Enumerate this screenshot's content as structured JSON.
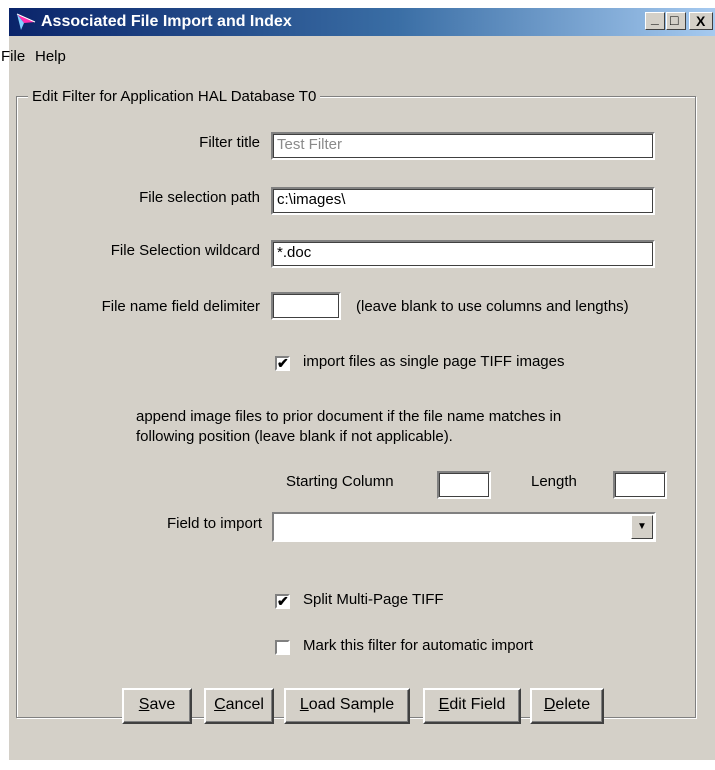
{
  "window": {
    "title": "Associated File Import and Index",
    "minimize_glyph": "_",
    "maximize_glyph": "□",
    "close_glyph": "X"
  },
  "menu": {
    "items": [
      "File",
      "Help"
    ]
  },
  "group": {
    "label": "Edit Filter for Application HAL  Database T0"
  },
  "form": {
    "filter_title_label": "Filter title",
    "filter_title_value": "Test Filter",
    "path_label": "File selection path",
    "path_value": "c:\\images\\",
    "wildcard_label": "File Selection wildcard",
    "wildcard_value": "*.doc",
    "delimiter_label": "File name field delimiter",
    "delimiter_value": "",
    "delimiter_hint": "(leave blank to use columns and lengths)",
    "tiff_label": "import files as single page TIFF images",
    "tiff_checked": "✔",
    "append_text_1": "append image files to prior document if the file name matches in",
    "append_text_2": "following position (leave blank if not applicable).",
    "start_col_label": "Starting Column",
    "start_col_value": "",
    "length_label": "Length",
    "length_value": "",
    "field_import_label": "Field to import",
    "field_import_value": "",
    "field_import_arrow": "▼",
    "split_label": "Split Multi-Page TIFF",
    "split_checked": "✔",
    "auto_label": "Mark this filter for automatic import",
    "auto_checked": ""
  },
  "buttons": {
    "save": {
      "mnemonic": "S",
      "rest": "ave"
    },
    "cancel": {
      "mnemonic": "C",
      "rest": "ancel"
    },
    "load_sample": {
      "mnemonic": "L",
      "rest": "oad Sample"
    },
    "edit_field": {
      "mnemonic": "E",
      "rest": "dit Field"
    },
    "delete": {
      "mnemonic": "D",
      "rest": "elete"
    }
  },
  "colors": {
    "face": "#d4d0c8",
    "title_start": "#0a246a",
    "title_end": "#a6caf0"
  }
}
